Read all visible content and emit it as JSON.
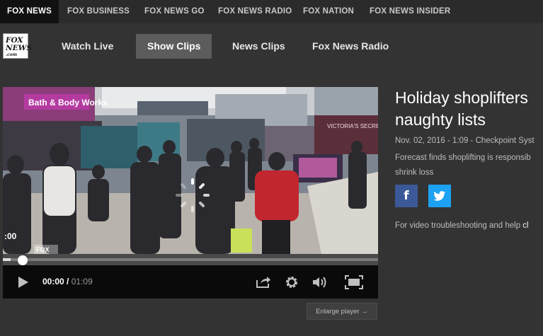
{
  "network_bar": {
    "brands": [
      "FOX NEWS",
      "FOX BUSINESS",
      "FOX NEWS GO",
      "FOX NEWS RADIO",
      "FOX NATION",
      "FOX NEWS INSIDER"
    ],
    "active": "FOX NEWS"
  },
  "nav": {
    "logo_lines": [
      "FOX",
      "NEWS",
      ".com"
    ],
    "items": [
      "Watch Live",
      "Show Clips",
      "News Clips",
      "Fox News Radio"
    ],
    "active": "Show Clips"
  },
  "player": {
    "overlay_time": ":00",
    "watermark": "FOX",
    "scene_text": [
      "Bath & Body Works",
      "VICTORIA'S SECRET"
    ],
    "progress_fraction": 0.02,
    "current_time": "00:00",
    "separator": " / ",
    "duration": "01:09",
    "enlarge_label": "Enlarge player →",
    "icons": [
      "play-icon",
      "share-icon",
      "gear-icon",
      "volume-icon",
      "fullscreen-icon",
      "loading-spinner-icon"
    ]
  },
  "article": {
    "headline_lines": [
      "Holiday shoplifters",
      "naughty lists"
    ],
    "meta": "Nov. 02, 2016 - 1:09 - Checkpoint Syst",
    "description_lines": [
      "Forecast finds shoplifting is responsib",
      "shrink loss"
    ],
    "share": {
      "facebook_glyph": "f"
    },
    "help_text": "For video troubleshooting and help ",
    "help_link": "cl"
  },
  "colors": {
    "background": "#333333",
    "network_bar": "#2b2b2b",
    "active_tab": "#5c5c5c",
    "facebook": "#3b5998",
    "twitter": "#1da1f2"
  }
}
